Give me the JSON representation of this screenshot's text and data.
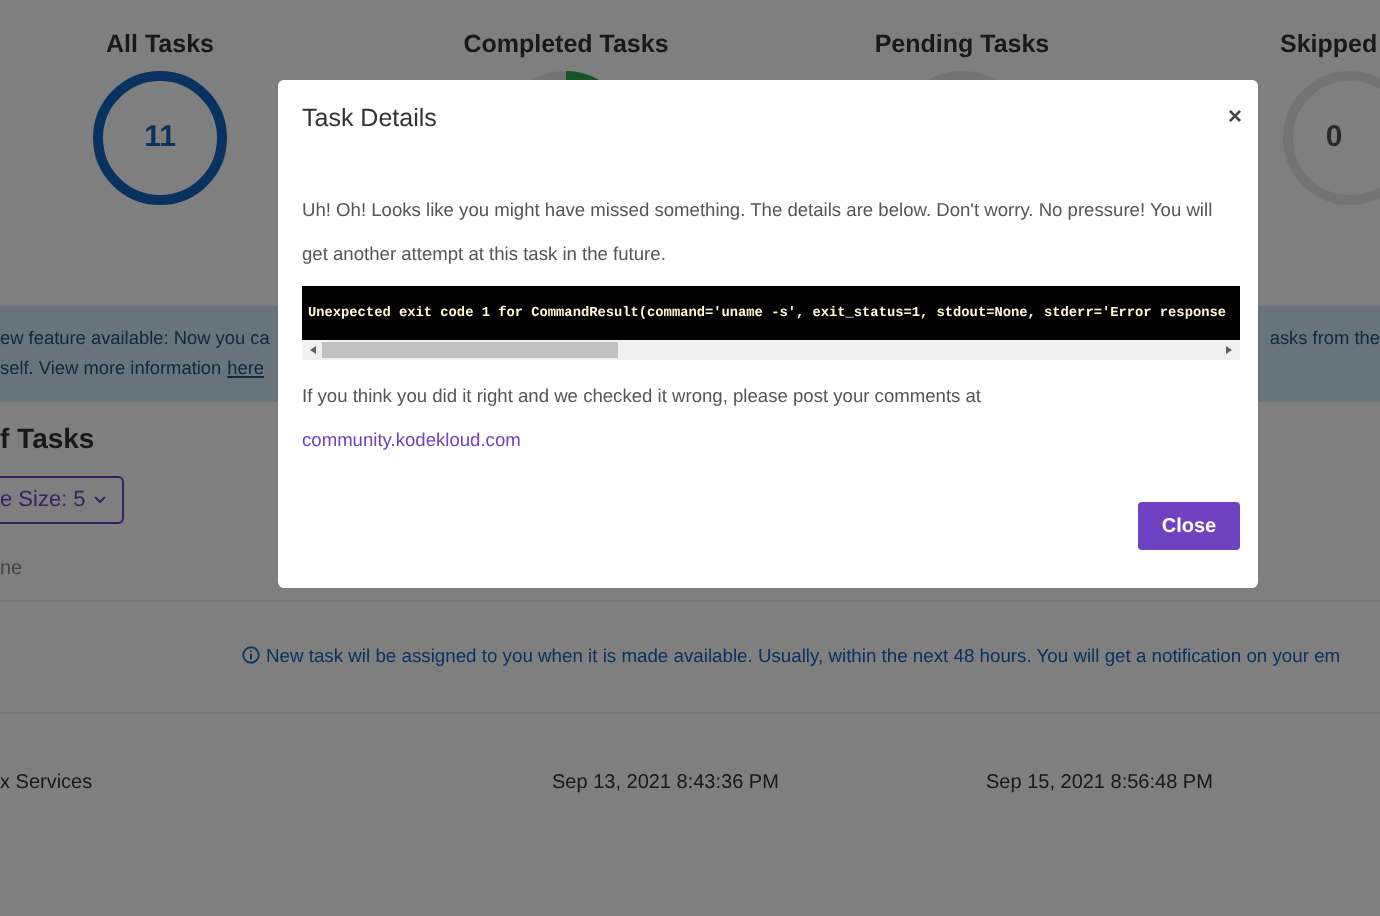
{
  "stats": [
    {
      "label": "All Tasks",
      "value": "11",
      "kind": "full"
    },
    {
      "label": "Completed Tasks",
      "kind": "partial"
    },
    {
      "label": "Pending Tasks",
      "kind": "empty"
    },
    {
      "label": "Skipped",
      "value": "0",
      "kind": "empty"
    }
  ],
  "banner": {
    "line_1_left": "ew feature available: Now you ca",
    "line_1_right": "asks from the",
    "line_2": "self. View more information",
    "link": "here"
  },
  "section_title": "f Tasks",
  "page_size_button": "e Size: 5",
  "column_header": "ne",
  "info_note": "New task wil be assigned to you when it is made available. Usually, within the next 48 hours. You will get a notification on your em",
  "rows": [
    {
      "cells": [
        "x Services",
        "Sep 13, 2021 8:43:36 PM",
        "Sep 15, 2021 8:56:48 PM"
      ]
    }
  ],
  "modal": {
    "title": "Task Details",
    "close": "×",
    "message": "Uh! Oh! Looks like you might have missed something. The details are below. Don't worry. No pressure! You will get another attempt at this task in the future.",
    "code": "Unexpected exit code 1 for CommandResult(command='uname -s', exit_status=1, stdout=None, stderr='Error response",
    "footnote": "If you think you did it right and we checked it wrong, please post your comments at",
    "link": "community.kodekloud.com",
    "button": "Close"
  }
}
